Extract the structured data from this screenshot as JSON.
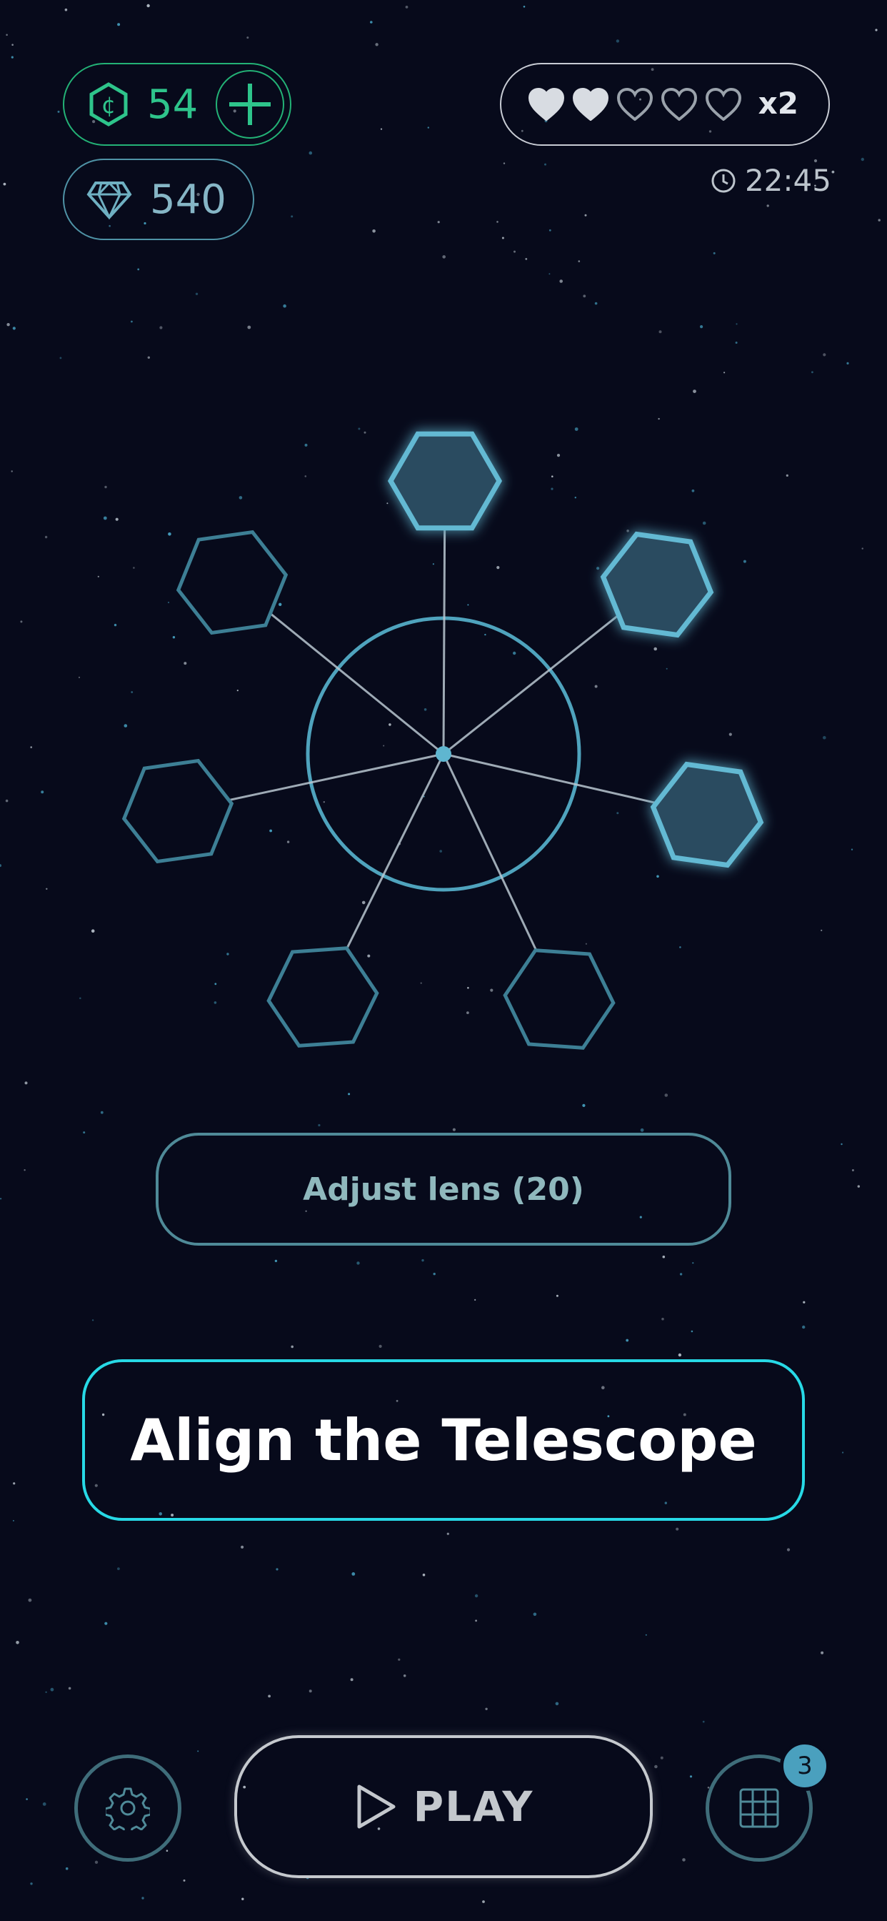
{
  "currency": {
    "coins": "54",
    "coin_icon": "coin-hex-icon",
    "add_icon": "plus-icon",
    "gems": "540",
    "gem_icon": "diamond-icon"
  },
  "lives": {
    "filled": 2,
    "total": 5,
    "multiplier": "x2",
    "timer": "22:45",
    "timer_icon": "clock-icon"
  },
  "puzzle": {
    "lens_slots_total": 7,
    "lens_slots_filled": 3
  },
  "actions": {
    "adjust_label": "Adjust lens (20)",
    "title": "Align the Telescope",
    "play_label": "PLAY",
    "badge_count": "3"
  },
  "colors": {
    "background": "#070a1b",
    "coin_green": "#2ec48b",
    "accent_cyan": "#27d9e6",
    "lens_blue": "#4aa0be"
  }
}
